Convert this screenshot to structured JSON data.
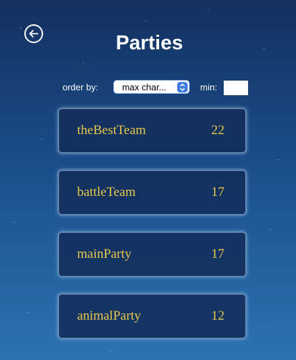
{
  "header": {
    "title": "Parties",
    "back_icon": "arrow-left-circle-icon"
  },
  "filters": {
    "order_label": "order by:",
    "order_value": "max char...",
    "min_label": "min:",
    "min_value": ""
  },
  "parties": [
    {
      "name": "theBestTeam",
      "count": "22"
    },
    {
      "name": "battleTeam",
      "count": "17"
    },
    {
      "name": "mainParty",
      "count": "17"
    },
    {
      "name": "animalParty",
      "count": "12"
    }
  ],
  "colors": {
    "accent_text": "#e8c84a",
    "select_arrow_bg": "#3d7be0"
  }
}
